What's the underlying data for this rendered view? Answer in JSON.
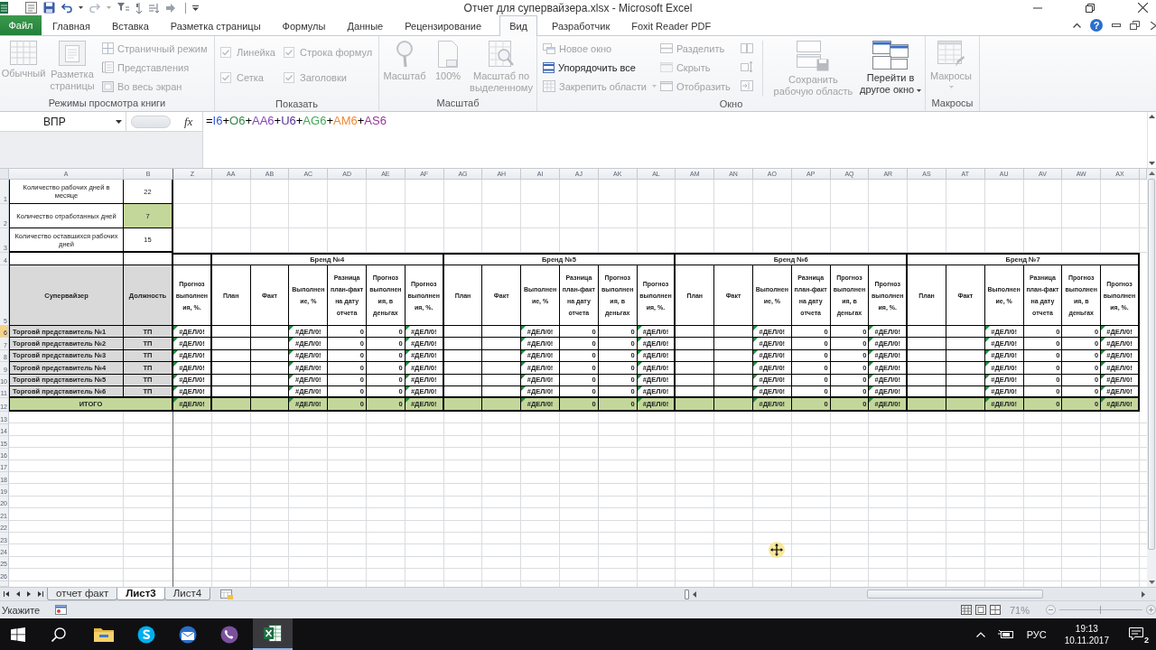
{
  "title_bar": {
    "title": "Отчет для супервайзера.xlsx - Microsoft Excel"
  },
  "ribbon": {
    "tabs": [
      {
        "label": "Файл",
        "kind": "file",
        "selected": false
      },
      {
        "label": "Главная",
        "kind": "tab",
        "selected": false
      },
      {
        "label": "Вставка",
        "kind": "tab",
        "selected": false
      },
      {
        "label": "Разметка страницы",
        "kind": "tab",
        "selected": false
      },
      {
        "label": "Формулы",
        "kind": "tab",
        "selected": false
      },
      {
        "label": "Данные",
        "kind": "tab",
        "selected": false
      },
      {
        "label": "Рецензирование",
        "kind": "tab",
        "selected": false
      },
      {
        "label": "Вид",
        "kind": "tab",
        "selected": true
      },
      {
        "label": "Разработчик",
        "kind": "tab",
        "selected": false
      },
      {
        "label": "Foxit Reader PDF",
        "kind": "tab",
        "selected": false
      }
    ],
    "help": "?",
    "groups": [
      {
        "label": "Режимы просмотра книги",
        "commands": [
          {
            "label": "Обычный",
            "disabled": true
          },
          {
            "label": "Разметка страницы",
            "disabled": true
          },
          {
            "label": "Страничный режим",
            "disabled": true
          },
          {
            "label": "Представления",
            "disabled": true
          },
          {
            "label": "Во весь экран",
            "disabled": true
          }
        ]
      },
      {
        "label": "Показать",
        "commands": [
          {
            "label": "Линейка",
            "checked": true,
            "disabled": true
          },
          {
            "label": "Строка формул",
            "checked": true,
            "disabled": true
          },
          {
            "label": "Сетка",
            "checked": true,
            "disabled": true
          },
          {
            "label": "Заголовки",
            "checked": true,
            "disabled": true
          }
        ]
      },
      {
        "label": "Масштаб",
        "commands": [
          {
            "label": "Масштаб",
            "disabled": true
          },
          {
            "label": "100%",
            "disabled": true
          },
          {
            "label": "Масштаб по выделенному",
            "disabled": true
          }
        ]
      },
      {
        "label": "Окно",
        "commands": [
          {
            "label": "Новое окно",
            "disabled": true
          },
          {
            "label": "Упорядочить все",
            "disabled": false
          },
          {
            "label": "Закрепить области",
            "disabled": true
          },
          {
            "label": "Разделить",
            "disabled": true
          },
          {
            "label": "Скрыть",
            "disabled": true
          },
          {
            "label": "Отобразить",
            "disabled": true
          },
          {
            "disabled": true
          },
          {
            "disabled": true
          },
          {
            "disabled": true
          },
          {
            "label": "Сохранить рабочую область",
            "disabled": true
          },
          {
            "label": "Перейти в другое окно",
            "disabled": false
          }
        ]
      },
      {
        "label": "Макросы",
        "commands": [
          {
            "label": "Макросы",
            "disabled": true
          }
        ]
      }
    ]
  },
  "formula_bar": {
    "name_box": "ВПР",
    "function_label": "fx",
    "formula": [
      {
        "text": "=",
        "color": "#000000"
      },
      {
        "text": "I6",
        "color": "#3355dd"
      },
      {
        "text": "+",
        "color": "#000000"
      },
      {
        "text": "O6",
        "color": "#33884d"
      },
      {
        "text": "+",
        "color": "#000000"
      },
      {
        "text": "AA6",
        "color": "#8844bb"
      },
      {
        "text": "+",
        "color": "#000000"
      },
      {
        "text": "U6",
        "color": "#553399"
      },
      {
        "text": "+",
        "color": "#000000"
      },
      {
        "text": "AG6",
        "color": "#44aa55"
      },
      {
        "text": "+",
        "color": "#000000"
      },
      {
        "text": "AM6",
        "color": "#ee8833"
      },
      {
        "text": "+",
        "color": "#000000"
      },
      {
        "text": "AS6",
        "color": "#993399"
      }
    ]
  },
  "sheet": {
    "columns": [
      "A",
      "B",
      "Z",
      "AA",
      "AB",
      "AC",
      "AD",
      "AE",
      "AF",
      "AG",
      "AH",
      "AI",
      "AJ",
      "AK",
      "AL",
      "AM",
      "AN",
      "AO",
      "AP",
      "AQ",
      "AR",
      "AS",
      "AT",
      "AU",
      "AV",
      "AW",
      "AX"
    ],
    "row_numbers": [
      {
        "label": "1",
        "selected": false
      },
      {
        "label": "2",
        "selected": false
      },
      {
        "label": "3",
        "selected": false
      },
      {
        "label": "4",
        "selected": false
      },
      {
        "label": "5",
        "selected": false
      },
      {
        "label": "6",
        "selected": true
      },
      {
        "label": "7",
        "selected": false
      },
      {
        "label": "8",
        "selected": false
      },
      {
        "label": "9",
        "selected": false
      },
      {
        "label": "10",
        "selected": false
      },
      {
        "label": "11",
        "selected": false
      },
      {
        "label": "12",
        "selected": false
      },
      {
        "label": "13",
        "selected": false
      },
      {
        "label": "14",
        "selected": false
      },
      {
        "label": "15",
        "selected": false
      },
      {
        "label": "16",
        "selected": false
      },
      {
        "label": "17",
        "selected": false
      },
      {
        "label": "18",
        "selected": false
      },
      {
        "label": "19",
        "selected": false
      },
      {
        "label": "20",
        "selected": false
      },
      {
        "label": "21",
        "selected": false
      },
      {
        "label": "22",
        "selected": false
      },
      {
        "label": "23",
        "selected": false
      },
      {
        "label": "24",
        "selected": false
      },
      {
        "label": "25",
        "selected": false
      },
      {
        "label": "26",
        "selected": false
      }
    ],
    "info_rows": [
      {
        "label": "Количество рабочих дней в месяце",
        "value": "22",
        "highlighted": false
      },
      {
        "label": "Количество отработанных дней",
        "value": "7",
        "highlighted": true
      },
      {
        "label": "Количество оставшихся рабочих дней",
        "value": "15",
        "highlighted": false
      }
    ],
    "header": {
      "supervisor": "Супервайзер",
      "position": "Должность",
      "forecast_pct": "Прогноз выполнения, %."
    },
    "brands": [
      {
        "title": "Бренд №4",
        "columns": [
          "План",
          "Факт",
          "Выполнение, %",
          "Разница план-факт на дату отчета",
          "Прогноз выполнения, в деньгах",
          "Прогноз выполнения, %."
        ]
      },
      {
        "title": "Бренд №5",
        "columns": [
          "План",
          "Факт",
          "Выполнение, %",
          "Разница план-факт на дату отчета",
          "Прогноз выполнения, в деньгах",
          "Прогноз выполнения, %."
        ]
      },
      {
        "title": "Бренд №6",
        "columns": [
          "План",
          "Факт",
          "Выполнение, %",
          "Разница план-факт на дату отчета",
          "Прогноз выполнения, в деньгах",
          "Прогноз выполнения, %."
        ]
      },
      {
        "title": "Бренд №7",
        "columns": [
          "План",
          "Факт",
          "Выполнение, %",
          "Разница план-факт на дату отчета",
          "Прогноз выполнения, в деньгах",
          "Прогноз выполнения, %."
        ]
      }
    ],
    "rows": [
      {
        "name": "Торговй представитель №1",
        "position": "ТП",
        "forecast_pct": {
          "text": "#ДЕЛ/0!",
          "flagged": true
        },
        "brands": [
          {
            "fulfillment": {
              "text": "#ДЕЛ/0!",
              "flagged": true
            },
            "difference": "0",
            "forecast_money": "0",
            "forecast_pct": {
              "text": "#ДЕЛ/0!",
              "flagged": true
            }
          },
          {
            "fulfillment": {
              "text": "#ДЕЛ/0!",
              "flagged": true
            },
            "difference": "0",
            "forecast_money": "0",
            "forecast_pct": {
              "text": "#ДЕЛ/0!",
              "flagged": true
            }
          },
          {
            "fulfillment": {
              "text": "#ДЕЛ/0!",
              "flagged": true
            },
            "difference": "0",
            "forecast_money": "0",
            "forecast_pct": {
              "text": "#ДЕЛ/0!",
              "flagged": true
            }
          },
          {
            "fulfillment": {
              "text": "#ДЕЛ/0!",
              "flagged": true
            },
            "difference": "0",
            "forecast_money": "0",
            "forecast_pct": {
              "text": "#ДЕЛ/0!",
              "flagged": true
            }
          }
        ]
      },
      {
        "name": "Торговй представитель №2",
        "position": "ТП",
        "forecast_pct": {
          "text": "#ДЕЛ/0!",
          "flagged": true
        },
        "brands": [
          {
            "fulfillment": {
              "text": "#ДЕЛ/0!",
              "flagged": true
            },
            "difference": "0",
            "forecast_money": "0",
            "forecast_pct": {
              "text": "#ДЕЛ/0!",
              "flagged": true
            }
          },
          {
            "fulfillment": {
              "text": "#ДЕЛ/0!",
              "flagged": true
            },
            "difference": "0",
            "forecast_money": "0",
            "forecast_pct": {
              "text": "#ДЕЛ/0!",
              "flagged": true
            }
          },
          {
            "fulfillment": {
              "text": "#ДЕЛ/0!",
              "flagged": true
            },
            "difference": "0",
            "forecast_money": "0",
            "forecast_pct": {
              "text": "#ДЕЛ/0!",
              "flagged": true
            }
          },
          {
            "fulfillment": {
              "text": "#ДЕЛ/0!",
              "flagged": true
            },
            "difference": "0",
            "forecast_money": "0",
            "forecast_pct": {
              "text": "#ДЕЛ/0!",
              "flagged": true
            }
          }
        ]
      },
      {
        "name": "Торговй представитель №3",
        "position": "ТП",
        "forecast_pct": {
          "text": "#ДЕЛ/0!",
          "flagged": true
        },
        "brands": [
          {
            "fulfillment": {
              "text": "#ДЕЛ/0!",
              "flagged": true
            },
            "difference": "0",
            "forecast_money": "0",
            "forecast_pct": {
              "text": "#ДЕЛ/0!",
              "flagged": true
            }
          },
          {
            "fulfillment": {
              "text": "#ДЕЛ/0!",
              "flagged": true
            },
            "difference": "0",
            "forecast_money": "0",
            "forecast_pct": {
              "text": "#ДЕЛ/0!",
              "flagged": true
            }
          },
          {
            "fulfillment": {
              "text": "#ДЕЛ/0!",
              "flagged": true
            },
            "difference": "0",
            "forecast_money": "0",
            "forecast_pct": {
              "text": "#ДЕЛ/0!",
              "flagged": true
            }
          },
          {
            "fulfillment": {
              "text": "#ДЕЛ/0!",
              "flagged": true
            },
            "difference": "0",
            "forecast_money": "0",
            "forecast_pct": {
              "text": "#ДЕЛ/0!",
              "flagged": true
            }
          }
        ]
      },
      {
        "name": "Торговй представитель №4",
        "position": "ТП",
        "forecast_pct": {
          "text": "#ДЕЛ/0!",
          "flagged": true
        },
        "brands": [
          {
            "fulfillment": {
              "text": "#ДЕЛ/0!",
              "flagged": true
            },
            "difference": "0",
            "forecast_money": "0",
            "forecast_pct": {
              "text": "#ДЕЛ/0!",
              "flagged": true
            }
          },
          {
            "fulfillment": {
              "text": "#ДЕЛ/0!",
              "flagged": true
            },
            "difference": "0",
            "forecast_money": "0",
            "forecast_pct": {
              "text": "#ДЕЛ/0!",
              "flagged": true
            }
          },
          {
            "fulfillment": {
              "text": "#ДЕЛ/0!",
              "flagged": true
            },
            "difference": "0",
            "forecast_money": "0",
            "forecast_pct": {
              "text": "#ДЕЛ/0!",
              "flagged": true
            }
          },
          {
            "fulfillment": {
              "text": "#ДЕЛ/0!",
              "flagged": true
            },
            "difference": "0",
            "forecast_money": "0",
            "forecast_pct": {
              "text": "#ДЕЛ/0!",
              "flagged": true
            }
          }
        ]
      },
      {
        "name": "Торговй представитель №5",
        "position": "ТП",
        "forecast_pct": {
          "text": "#ДЕЛ/0!",
          "flagged": true
        },
        "brands": [
          {
            "fulfillment": {
              "text": "#ДЕЛ/0!",
              "flagged": true
            },
            "difference": "0",
            "forecast_money": "0",
            "forecast_pct": {
              "text": "#ДЕЛ/0!",
              "flagged": true
            }
          },
          {
            "fulfillment": {
              "text": "#ДЕЛ/0!",
              "flagged": true
            },
            "difference": "0",
            "forecast_money": "0",
            "forecast_pct": {
              "text": "#ДЕЛ/0!",
              "flagged": true
            }
          },
          {
            "fulfillment": {
              "text": "#ДЕЛ/0!",
              "flagged": true
            },
            "difference": "0",
            "forecast_money": "0",
            "forecast_pct": {
              "text": "#ДЕЛ/0!",
              "flagged": true
            }
          },
          {
            "fulfillment": {
              "text": "#ДЕЛ/0!",
              "flagged": true
            },
            "difference": "0",
            "forecast_money": "0",
            "forecast_pct": {
              "text": "#ДЕЛ/0!",
              "flagged": true
            }
          }
        ]
      },
      {
        "name": "Торговй представитель №6",
        "position": "ТП",
        "forecast_pct": {
          "text": "#ДЕЛ/0!",
          "flagged": true
        },
        "brands": [
          {
            "fulfillment": {
              "text": "#ДЕЛ/0!",
              "flagged": true
            },
            "difference": "0",
            "forecast_money": "0",
            "forecast_pct": {
              "text": "#ДЕЛ/0!",
              "flagged": true
            }
          },
          {
            "fulfillment": {
              "text": "#ДЕЛ/0!",
              "flagged": true
            },
            "difference": "0",
            "forecast_money": "0",
            "forecast_pct": {
              "text": "#ДЕЛ/0!",
              "flagged": true
            }
          },
          {
            "fulfillment": {
              "text": "#ДЕЛ/0!",
              "flagged": true
            },
            "difference": "0",
            "forecast_money": "0",
            "forecast_pct": {
              "text": "#ДЕЛ/0!",
              "flagged": true
            }
          },
          {
            "fulfillment": {
              "text": "#ДЕЛ/0!",
              "flagged": true
            },
            "difference": "0",
            "forecast_money": "0",
            "forecast_pct": {
              "text": "#ДЕЛ/0!",
              "flagged": true
            }
          }
        ]
      }
    ],
    "total": {
      "label": "ИТОГО",
      "forecast_pct": {
        "text": "#ДЕЛ/0!",
        "flagged": true
      },
      "brands": [
        {
          "fulfillment": {
            "text": "#ДЕЛ/0!",
            "flagged": true
          },
          "difference": "0",
          "forecast_money": "0",
          "forecast_pct": {
            "text": "#ДЕЛ/0!",
            "flagged": true
          }
        },
        {
          "fulfillment": {
            "text": "#ДЕЛ/0!",
            "flagged": true
          },
          "difference": "0",
          "forecast_money": "0",
          "forecast_pct": {
            "text": "#ДЕЛ/0!",
            "flagged": true
          }
        },
        {
          "fulfillment": {
            "text": "#ДЕЛ/0!",
            "flagged": true
          },
          "difference": "0",
          "forecast_money": "0",
          "forecast_pct": {
            "text": "#ДЕЛ/0!",
            "flagged": true
          }
        },
        {
          "fulfillment": {
            "text": "#ДЕЛ/0!",
            "flagged": true
          },
          "difference": "0",
          "forecast_money": "0",
          "forecast_pct": {
            "text": "#ДЕЛ/0!",
            "flagged": true
          }
        }
      ]
    }
  },
  "sheet_tabs": [
    {
      "label": "отчет факт",
      "selected": false
    },
    {
      "label": "Лист3",
      "selected": true
    },
    {
      "label": "Лист4",
      "selected": false
    }
  ],
  "status_bar": {
    "mode": "Укажите",
    "zoom": "71%",
    "zoom_slider": {
      "level": 0.49
    }
  },
  "taskbar": {
    "language": "РУС",
    "time": "19:13",
    "date": "10.11.2017",
    "notifications": "2"
  }
}
